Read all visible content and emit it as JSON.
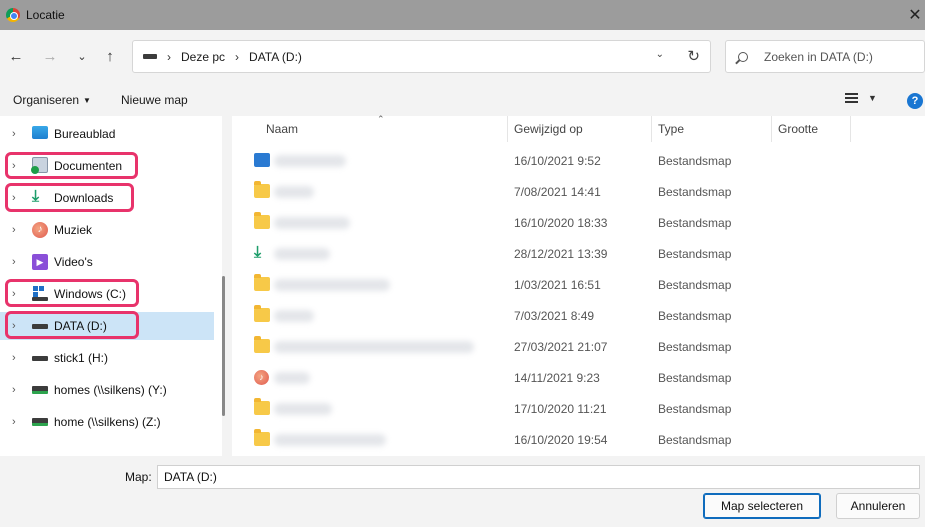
{
  "window": {
    "title": "Locatie",
    "close_glyph": "✕"
  },
  "nav": {
    "back_glyph": "←",
    "forward_glyph": "→",
    "recent_glyph": "⌄",
    "up_glyph": "↑",
    "breadcrumbs": [
      "Deze pc",
      "DATA (D:)"
    ],
    "search_placeholder": "Zoeken in DATA (D:)"
  },
  "commands": {
    "organize": "Organiseren",
    "new_folder": "Nieuwe map",
    "help": "?"
  },
  "sidebar": {
    "items": [
      {
        "label": "Bureaublad",
        "icon": "desktop-icon"
      },
      {
        "label": "Documenten",
        "icon": "documents-icon"
      },
      {
        "label": "Downloads",
        "icon": "downloads-icon"
      },
      {
        "label": "Muziek",
        "icon": "music-icon"
      },
      {
        "label": "Video's",
        "icon": "videos-icon"
      },
      {
        "label": "Windows (C:)",
        "icon": "windows-drive-icon"
      },
      {
        "label": "DATA (D:)",
        "icon": "drive-icon",
        "selected": true
      },
      {
        "label": "stick1 (H:)",
        "icon": "drive-icon"
      },
      {
        "label": "homes (\\\\silkens) (Y:)",
        "icon": "network-drive-icon"
      },
      {
        "label": "home (\\\\silkens) (Z:)",
        "icon": "network-drive-icon"
      }
    ]
  },
  "file_list": {
    "columns": [
      "Naam",
      "Gewijzigd op",
      "Type",
      "Grootte"
    ],
    "rows": [
      {
        "icon": "pictures-folder-icon",
        "date": "16/10/2021 9:52",
        "type": "Bestandsmap"
      },
      {
        "icon": "folder-icon",
        "date": "7/08/2021 14:41",
        "type": "Bestandsmap"
      },
      {
        "icon": "folder-icon",
        "date": "16/10/2020 18:33",
        "type": "Bestandsmap"
      },
      {
        "icon": "downloads-folder-icon",
        "date": "28/12/2021 13:39",
        "type": "Bestandsmap"
      },
      {
        "icon": "folder-icon",
        "date": "1/03/2021 16:51",
        "type": "Bestandsmap"
      },
      {
        "icon": "folder-icon",
        "date": "7/03/2021 8:49",
        "type": "Bestandsmap"
      },
      {
        "icon": "folder-icon",
        "date": "27/03/2021 21:07",
        "type": "Bestandsmap"
      },
      {
        "icon": "music-folder-icon",
        "date": "14/11/2021 9:23",
        "type": "Bestandsmap"
      },
      {
        "icon": "folder-icon",
        "date": "17/10/2020 11:21",
        "type": "Bestandsmap"
      },
      {
        "icon": "folder-icon",
        "date": "16/10/2020 19:54",
        "type": "Bestandsmap"
      }
    ]
  },
  "footer": {
    "map_label": "Map:",
    "map_value": "DATA (D:)",
    "select_button": "Map selecteren",
    "cancel_button": "Annuleren"
  },
  "colors": {
    "highlight": "#e8336b",
    "selected": "#cce4f7",
    "accent": "#0f6cbd"
  }
}
